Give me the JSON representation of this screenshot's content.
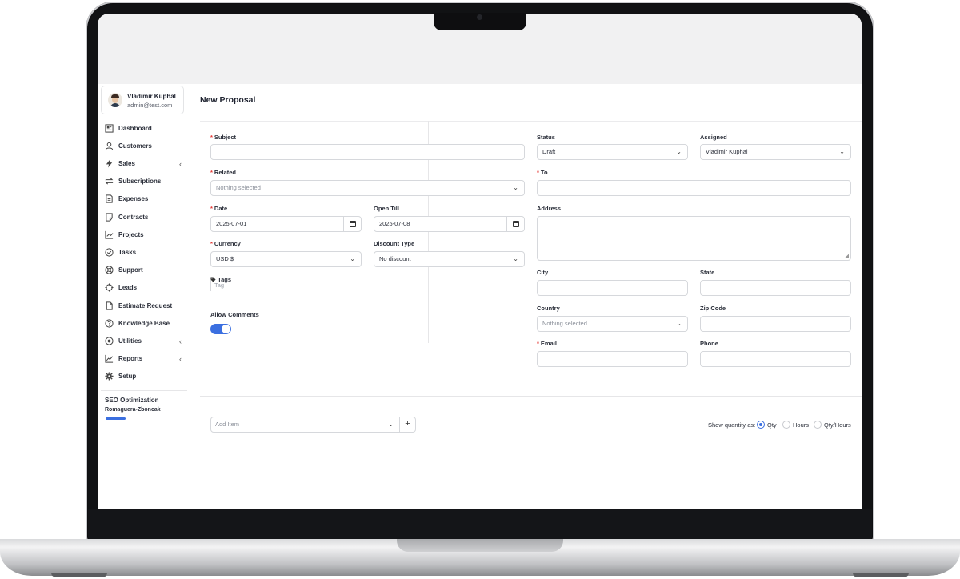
{
  "user": {
    "name": "Vladimir Kuphal",
    "email": "admin@test.com"
  },
  "sidebar": {
    "items": [
      {
        "label": "Dashboard",
        "icon": "dashboard-icon",
        "has_children": false
      },
      {
        "label": "Customers",
        "icon": "user-icon",
        "has_children": false
      },
      {
        "label": "Sales",
        "icon": "bolt-icon",
        "has_children": true
      },
      {
        "label": "Subscriptions",
        "icon": "repeat-icon",
        "has_children": false
      },
      {
        "label": "Expenses",
        "icon": "document-icon",
        "has_children": false
      },
      {
        "label": "Contracts",
        "icon": "contract-icon",
        "has_children": false
      },
      {
        "label": "Projects",
        "icon": "chart-icon",
        "has_children": false
      },
      {
        "label": "Tasks",
        "icon": "check-circle-icon",
        "has_children": false
      },
      {
        "label": "Support",
        "icon": "lifebuoy-icon",
        "has_children": false
      },
      {
        "label": "Leads",
        "icon": "target-icon",
        "has_children": false
      },
      {
        "label": "Estimate Request",
        "icon": "file-icon",
        "has_children": false
      },
      {
        "label": "Knowledge Base",
        "icon": "question-icon",
        "has_children": false
      },
      {
        "label": "Utilities",
        "icon": "record-icon",
        "has_children": true
      },
      {
        "label": "Reports",
        "icon": "line-chart-icon",
        "has_children": true
      },
      {
        "label": "Setup",
        "icon": "gear-icon",
        "has_children": false
      }
    ],
    "project": {
      "title": "SEO Optimization",
      "client": "Romaguera-Zboncak"
    }
  },
  "page": {
    "title": "New Proposal"
  },
  "form": {
    "subject": {
      "label": "Subject",
      "value": ""
    },
    "related": {
      "label": "Related",
      "placeholder": "Nothing selected"
    },
    "date": {
      "label": "Date",
      "value": "2025-07-01"
    },
    "open_till": {
      "label": "Open Till",
      "value": "2025-07-08"
    },
    "currency": {
      "label": "Currency",
      "value": "USD $"
    },
    "discount_type": {
      "label": "Discount Type",
      "value": "No discount"
    },
    "tags": {
      "label": "Tags",
      "placeholder": "Tag"
    },
    "allow_comments": {
      "label": "Allow Comments",
      "enabled": true
    },
    "status": {
      "label": "Status",
      "value": "Draft"
    },
    "assigned": {
      "label": "Assigned",
      "value": "Vladimir Kuphal"
    },
    "to": {
      "label": "To",
      "value": ""
    },
    "address": {
      "label": "Address",
      "value": ""
    },
    "city": {
      "label": "City",
      "value": ""
    },
    "state": {
      "label": "State",
      "value": ""
    },
    "country": {
      "label": "Country",
      "placeholder": "Nothing selected"
    },
    "zip": {
      "label": "Zip Code",
      "value": ""
    },
    "email": {
      "label": "Email",
      "value": ""
    },
    "phone": {
      "label": "Phone",
      "value": ""
    }
  },
  "items": {
    "add_placeholder": "Add Item",
    "plus_symbol": "+",
    "show_quantity_label": "Show quantity as:",
    "options": [
      "Qty",
      "Hours",
      "Qty/Hours"
    ],
    "selected": "Qty"
  },
  "colors": {
    "accent": "#3b6fe0",
    "required": "#e53935"
  },
  "symbols": {
    "required": "*",
    "chevron_down": "⌄",
    "chevron_left": "‹"
  }
}
